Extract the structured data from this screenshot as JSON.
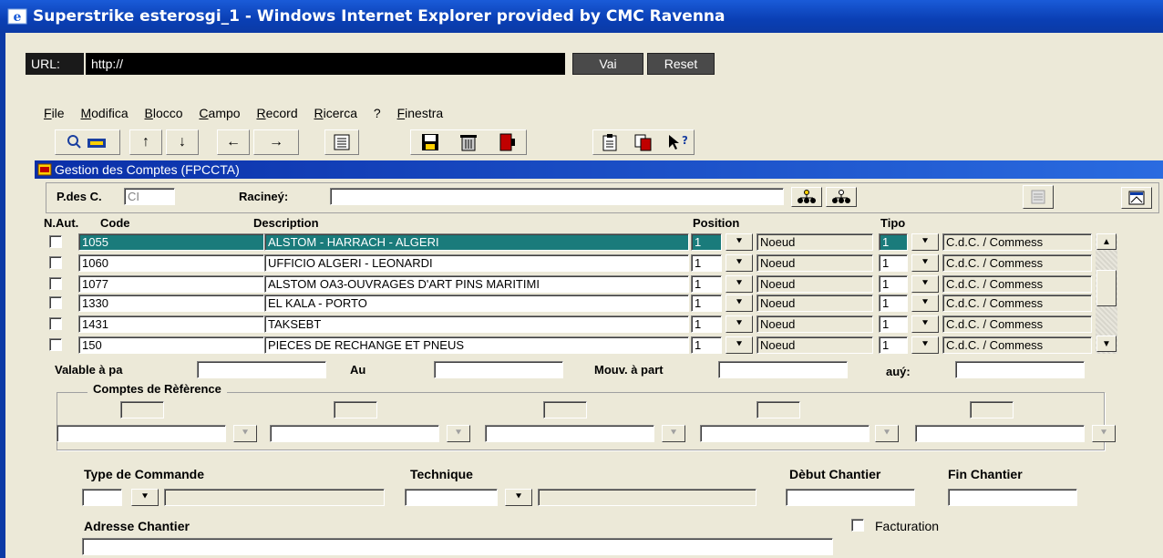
{
  "window": {
    "title": "Superstrike esterosgi_1 - Windows Internet Explorer provided by CMC Ravenna"
  },
  "urlbar": {
    "label": "URL:",
    "value": "http://",
    "go": "Vai",
    "reset": "Reset"
  },
  "menu": [
    {
      "key": "F",
      "rest": "ile"
    },
    {
      "key": "M",
      "rest": "odifica"
    },
    {
      "key": "B",
      "rest": "locco"
    },
    {
      "key": "C",
      "rest": "ampo"
    },
    {
      "key": "R",
      "rest": "ecord"
    },
    {
      "key": "R",
      "rest": "icerca"
    },
    {
      "key": "",
      "rest": "?"
    },
    {
      "key": "F",
      "rest": "inestra"
    }
  ],
  "toolbar_icons": [
    "query-icon",
    "arrow-up-icon",
    "arrow-down-icon",
    "arrow-left-icon",
    "arrow-right-icon",
    "list-icon",
    "save-icon",
    "delete-icon",
    "exit-icon",
    "clipboard-icon",
    "copy-icon",
    "help-icon"
  ],
  "form": {
    "title": "Gestion des Comptes (FPCCTA)",
    "pdesc_label": "P.des C.",
    "pdesc_value": "CI",
    "racine_label": "Racineý:",
    "racine_value": ""
  },
  "table": {
    "headers": {
      "naut": "N.Aut.",
      "code": "Code",
      "description": "Description",
      "position": "Position",
      "tipo": "Tipo"
    },
    "rows": [
      {
        "code": "1055",
        "description": "ALSTOM - HARRACH - ALGERI",
        "pos": "1",
        "noeud": "Noeud",
        "tipo": "1",
        "cdc": "C.d.C. / Commess"
      },
      {
        "code": "1060",
        "description": "UFFICIO  ALGERI - LEONARDI",
        "pos": "1",
        "noeud": "Noeud",
        "tipo": "1",
        "cdc": "C.d.C. / Commess"
      },
      {
        "code": "1077",
        "description": "ALSTOM  OA3-OUVRAGES D'ART PINS MARITIMI",
        "pos": "1",
        "noeud": "Noeud",
        "tipo": "1",
        "cdc": "C.d.C. / Commess"
      },
      {
        "code": "1330",
        "description": "EL KALA - PORTO",
        "pos": "1",
        "noeud": "Noeud",
        "tipo": "1",
        "cdc": "C.d.C. / Commess"
      },
      {
        "code": "1431",
        "description": "TAKSEBT",
        "pos": "1",
        "noeud": "Noeud",
        "tipo": "1",
        "cdc": "C.d.C. / Commess"
      },
      {
        "code": "150",
        "description": "PIECES DE RECHANGE ET PNEUS",
        "pos": "1",
        "noeud": "Noeud",
        "tipo": "1",
        "cdc": "C.d.C. / Commess"
      }
    ]
  },
  "dates": {
    "valable": "Valable à pa",
    "au": "Au",
    "mouv": "Mouv. à part",
    "auy": "auý:"
  },
  "refs": {
    "title": "Comptes de Rèfèrence"
  },
  "bottom": {
    "type_cmd": "Type de Commande",
    "technique": "Technique",
    "debut": "Dèbut Chantier",
    "fin": "Fin Chantier",
    "adresse": "Adresse Chantier",
    "facturation": "Facturation"
  },
  "colors": {
    "title_bar": "#0b3aa6",
    "selected_row": "#1a7b7b",
    "panel": "#ece9d8"
  }
}
